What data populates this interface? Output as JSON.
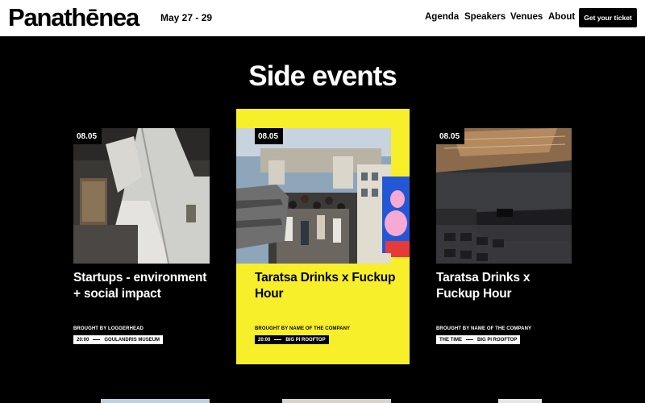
{
  "header": {
    "logo": "Panathēnea",
    "dates": "May 27 - 29",
    "nav": [
      "Agenda",
      "Speakers",
      "Venues",
      "About"
    ],
    "cta": "Get your ticket"
  },
  "section": {
    "title": "Side events"
  },
  "events": [
    {
      "date": "08.05",
      "title": "Startups - environment + social impact",
      "brought_by": "BROUGHT BY LOGGERHEAD",
      "time": "20:00",
      "venue": "GOULANDRIS MUSEUM"
    },
    {
      "date": "08.05",
      "title": "Taratsa Drinks x Fuckup Hour",
      "brought_by": "BROUGHT BY NAME OF THE COMPANY",
      "time": "20:00",
      "venue": "BIG PI ROOFTOP"
    },
    {
      "date": "08.05",
      "title": "Taratsa Drinks x Fuckup Hour",
      "brought_by": "BROUGHT BY NAME OF THE COMPANY",
      "time": "THE TIME",
      "venue": "BIG PI ROOFTOP"
    }
  ],
  "colors": {
    "accent_yellow": "#f7ef2a",
    "background": "#000000",
    "header_bg": "#ffffff"
  }
}
